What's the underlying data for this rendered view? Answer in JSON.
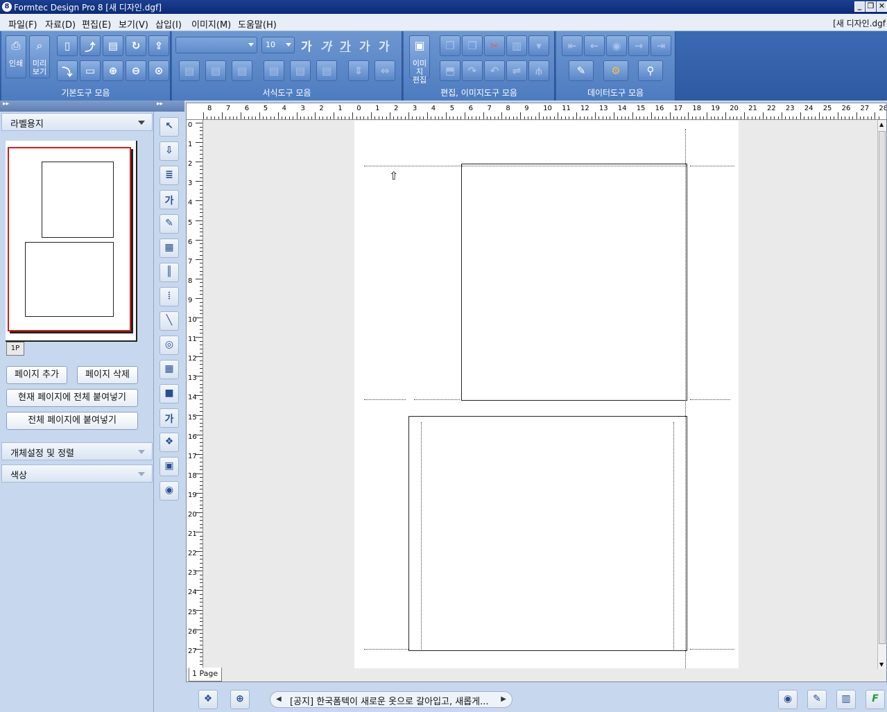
{
  "window": {
    "title": "Formtec Design Pro 8 [새 디자인.dgf]",
    "app_icon": "8",
    "doc_name": "[새 디자인.dgf"
  },
  "menu": [
    "파일(F)",
    "자료(D)",
    "편집(E)",
    "보기(V)",
    "삽입(I)",
    "이미지(M)",
    "도움말(H)"
  ],
  "toolbar": {
    "basic": {
      "label": "기본도구 모음",
      "print_label": "인쇄",
      "preview_label": "미리\n보기"
    },
    "format": {
      "label": "서식도구 모음",
      "font_size": "10",
      "text_glyphs": [
        "가",
        "가",
        "가",
        "가",
        "가"
      ]
    },
    "edit": {
      "label": "편집, 이미지도구 모음",
      "image_edit_label": "이미지\n편집"
    },
    "data": {
      "label": "데이터도구 모음"
    }
  },
  "left_panel": {
    "top_arrows": "▸▸",
    "label_paper": "라벨용지",
    "page_tab": "1P",
    "buttons": {
      "add_page": "페이지 추가",
      "delete_page": "페이지 삭제",
      "paste_all_current": "현재 페이지에 전체 붙여넣기",
      "paste_all_pages": "전체 페이지에 붙여넣기"
    },
    "object_settings": "개체설정 및 정렬",
    "color": "색상"
  },
  "tool_strip": {
    "top_arrows": "▸▸",
    "tools": [
      {
        "icon": "pointer-icon",
        "glyph": "↖"
      },
      {
        "icon": "import-icon",
        "glyph": "⇩"
      },
      {
        "icon": "textbox-icon",
        "glyph": "≣"
      },
      {
        "icon": "vertical-text-icon",
        "glyph": "가"
      },
      {
        "icon": "text-effect-icon",
        "glyph": "✎"
      },
      {
        "icon": "qrcode-icon",
        "glyph": "▦"
      },
      {
        "icon": "barcode-icon",
        "glyph": "║"
      },
      {
        "icon": "barcode2-icon",
        "glyph": "⦙"
      },
      {
        "icon": "line-icon",
        "glyph": "╲"
      },
      {
        "icon": "shape-icon",
        "glyph": "◎"
      },
      {
        "icon": "table-icon",
        "glyph": "▦"
      },
      {
        "icon": "gradient-icon",
        "glyph": "■"
      },
      {
        "icon": "wordart-icon",
        "glyph": "가"
      },
      {
        "icon": "clipart-icon",
        "glyph": "❖"
      },
      {
        "icon": "image-icon",
        "glyph": "▣"
      },
      {
        "icon": "cd-label-icon",
        "glyph": "◉"
      }
    ]
  },
  "ruler": {
    "h_labels": [
      "8",
      "7",
      "6",
      "5",
      "4",
      "3",
      "2",
      "1",
      "0",
      "1",
      "2",
      "3",
      "4",
      "5",
      "6",
      "7",
      "8",
      "9",
      "10",
      "11",
      "12",
      "13",
      "14",
      "15",
      "16",
      "17",
      "18",
      "19",
      "20",
      "21",
      "22",
      "23",
      "24",
      "25",
      "26",
      "27",
      "28"
    ],
    "v_labels": [
      "0",
      "1",
      "2",
      "3",
      "4",
      "5",
      "6",
      "7",
      "8",
      "9",
      "10",
      "11",
      "12",
      "13",
      "14",
      "15",
      "16",
      "17",
      "18",
      "19",
      "20",
      "21",
      "22",
      "23",
      "24",
      "25",
      "26",
      "27"
    ]
  },
  "canvas": {
    "page_tab": "1 Page",
    "cursor_icon": "⇧"
  },
  "statusbar": {
    "notice": "[공지] 한국폼텍이 새로운 옷으로 갈아입고, 새롭게...",
    "left_icons": [
      "clipart-icon",
      "new-icon"
    ],
    "right_icons": [
      "cd-icon",
      "note-icon",
      "shop-icon",
      "formtec-icon"
    ],
    "right_glyphs": [
      "◉",
      "✎",
      "▥",
      "F"
    ]
  }
}
